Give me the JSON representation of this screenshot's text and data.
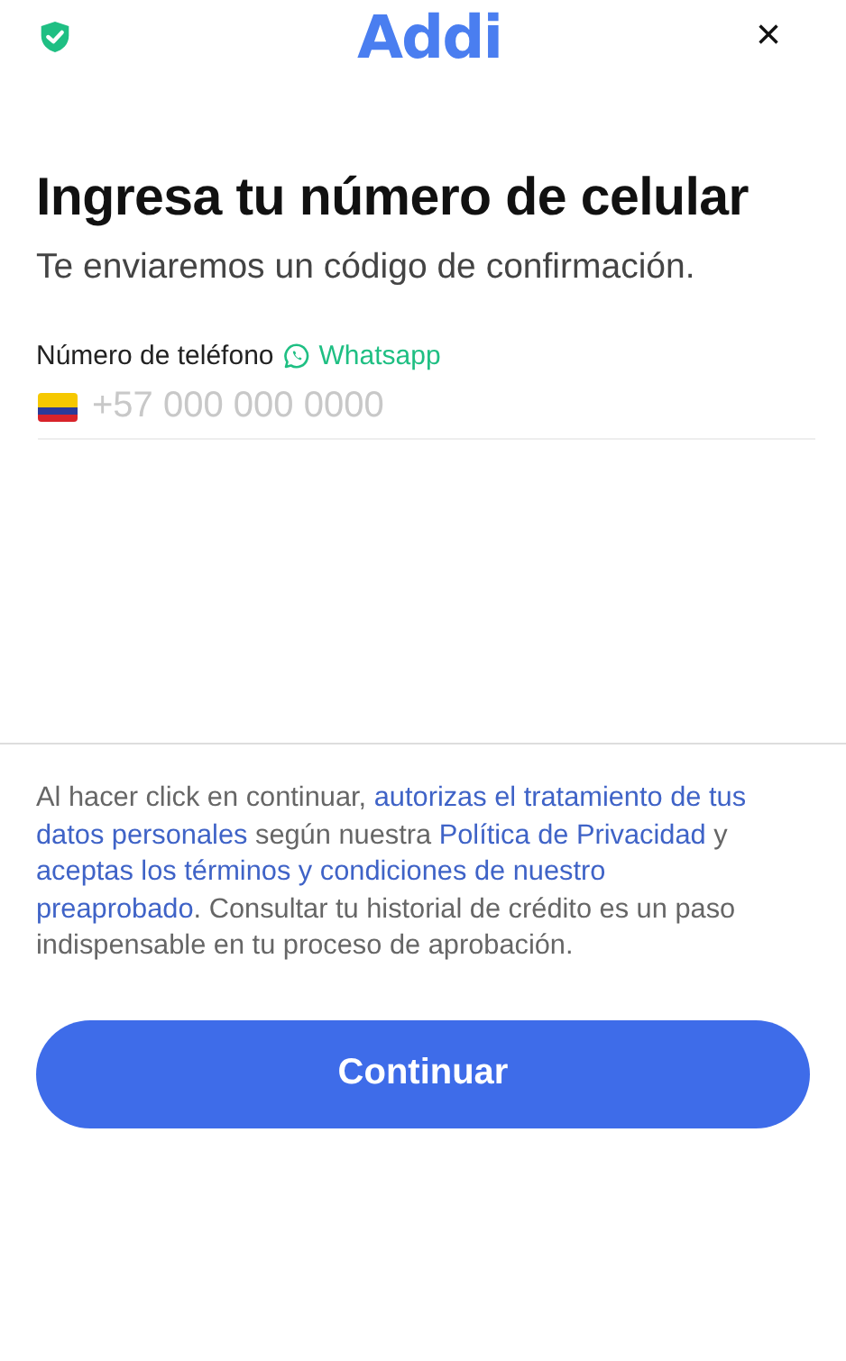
{
  "header": {
    "logo": "Addi",
    "close": "×"
  },
  "title": "Ingresa tu número de celular",
  "subtitle": "Te enviaremos un código de confirmación.",
  "phone": {
    "label": "Número de teléfono",
    "channel": "Whatsapp",
    "placeholder": "+57 000 000 0000"
  },
  "consent": [
    {
      "kind": "text",
      "text": "Al hacer click en continuar, "
    },
    {
      "kind": "link",
      "text": "autorizas el tratamiento de tus"
    },
    {
      "kind": "link",
      "text": "datos personales"
    },
    {
      "kind": "text",
      "text": " según nuestra "
    },
    {
      "kind": "link",
      "text": "Política de Privacidad"
    },
    {
      "kind": "text",
      "text": " y "
    },
    {
      "kind": "link",
      "text": "aceptas los términos y condiciones de nuestro"
    },
    {
      "kind": "link",
      "text": "preaprobado"
    },
    {
      "kind": "text",
      "text": ". Consultar tu historial de crédito es un paso indispensable en tu proceso de aprobación."
    }
  ],
  "button": "Continuar"
}
